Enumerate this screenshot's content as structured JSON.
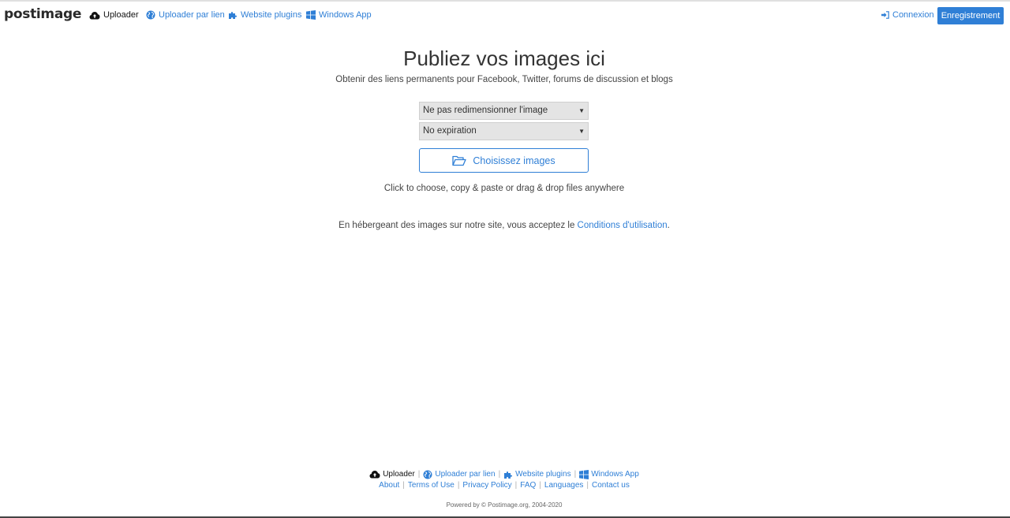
{
  "header": {
    "logo_main": "postim",
    "logo_rest": "age",
    "nav": {
      "uploader": "Uploader",
      "uploader_link": "Uploader par lien",
      "plugins": "Website plugins",
      "windows_app": "Windows App"
    },
    "login": "Connexion",
    "register": "Enregistrement"
  },
  "main": {
    "title": "Publiez vos images ici",
    "subtitle": "Obtenir des liens permanents pour Facebook, Twitter, forums de discussion et blogs",
    "resize_select": "Ne pas redimensionner l'image",
    "expiration_select": "No expiration",
    "choose_button": "Choisissez images",
    "hint": "Click to choose, copy & paste or drag & drop files anywhere",
    "terms_prefix": "En hébergeant des images sur notre site, vous acceptez le ",
    "terms_link": "Conditions d'utilisation",
    "terms_suffix": "."
  },
  "footer": {
    "uploader": "Uploader",
    "uploader_link": "Uploader par lien",
    "plugins": "Website plugins",
    "windows_app": "Windows App",
    "about": "About",
    "terms_of_use": "Terms of Use",
    "privacy": "Privacy Policy",
    "faq": "FAQ",
    "languages": "Languages",
    "contact": "Contact us",
    "powered": "Powered by © Postimage.org, 2004-2020"
  },
  "colors": {
    "accent": "#2f7fd6",
    "text": "#333333",
    "select_bg": "#e4e4e4"
  },
  "icons": [
    "cloud-upload-icon",
    "globe-icon",
    "puzzle-icon",
    "windows-icon",
    "sign-in-icon",
    "folder-open-icon",
    "caret-down-icon"
  ]
}
